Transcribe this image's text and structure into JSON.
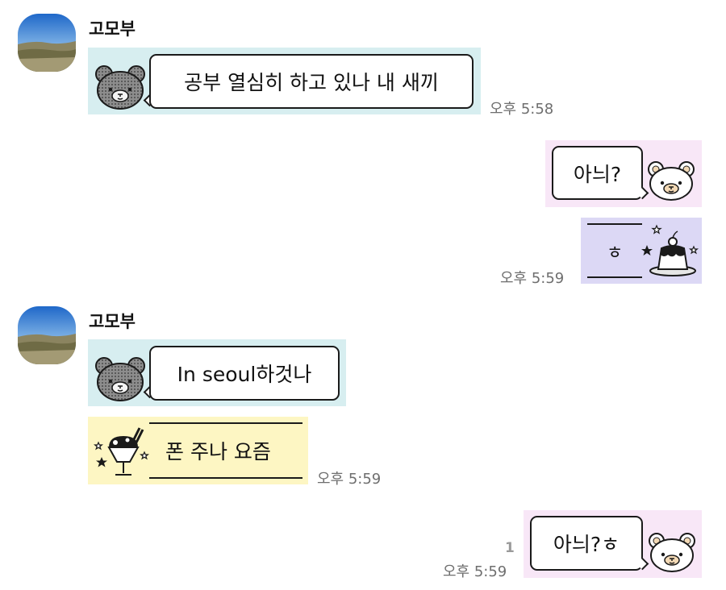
{
  "chat": {
    "colors": {
      "teal_bg": "#d7eef0",
      "pink_bg": "#f8e7f7",
      "lavender_bg": "#dcd8f5",
      "yellow_bg": "#fdf6c3",
      "time_text": "#6e6e6e"
    },
    "messages": [
      {
        "id": "m1",
        "sender": "고모부",
        "text": "공부 열심히 하고 있나 내 새끼",
        "time": "오후 5:58",
        "sticker": "grey-bear"
      },
      {
        "id": "m2",
        "text": "아늬?",
        "sticker": "white-bear"
      },
      {
        "id": "m3",
        "text": "ㅎ",
        "time": "오후 5:59",
        "sticker": "pudding"
      },
      {
        "id": "m4",
        "sender": "고모부",
        "text": "In seoul하것나",
        "sticker": "grey-bear"
      },
      {
        "id": "m5",
        "text": "폰 주나 요즘",
        "time": "오후 5:59",
        "sticker": "parfait"
      },
      {
        "id": "m6",
        "text": "아늬?ㅎ",
        "time": "오후 5:59",
        "unread": "1",
        "sticker": "white-bear"
      }
    ]
  }
}
